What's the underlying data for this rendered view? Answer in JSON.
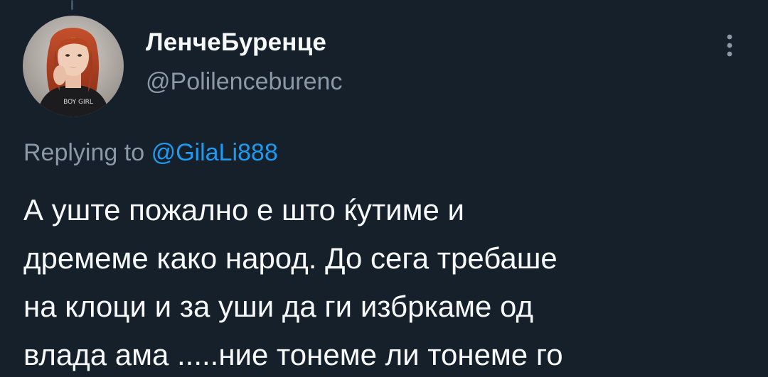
{
  "author": {
    "display_name": "ЛенчеБуренце",
    "handle": "@Polilenceburenc",
    "avatar_text": "BOY GIRL"
  },
  "reply": {
    "prefix": "Replying to",
    "mention": "@GilaLi888"
  },
  "tweet": {
    "lines": [
      "А уште пожално е што ќутиме и",
      "дремеме како народ. До сега требаше",
      "на клоци и за уши да ги избркаме од",
      "влада ама .....ние тонеме ли тонеме го"
    ]
  },
  "menu": {
    "icon": "more-vertical-icon"
  },
  "colors": {
    "background": "#15202b",
    "primary_text": "#f7f9f9",
    "secondary_text": "#8b98a5",
    "accent": "#1d9bf0"
  }
}
